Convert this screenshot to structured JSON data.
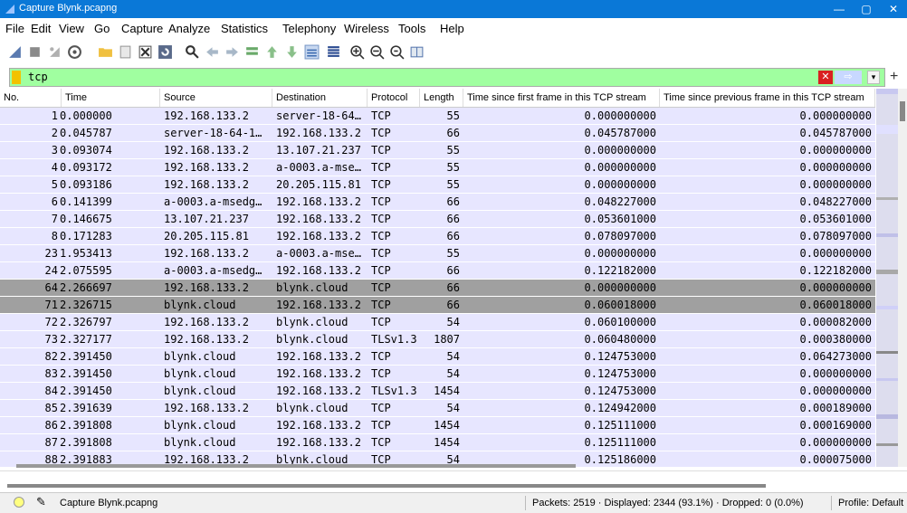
{
  "window": {
    "title": "Capture Blynk.pcapng",
    "minimize": "—",
    "maximize": "▢",
    "close": "✕"
  },
  "menu": [
    "File",
    "Edit",
    "View",
    "Go",
    "Capture",
    "Analyze",
    "Statistics",
    "Telephony",
    "Wireless",
    "Tools",
    "Help"
  ],
  "toolbar": [
    "shark-fin-start-icon",
    "stop-icon",
    "restart-icon",
    "options-gear-icon",
    "open-folder-icon",
    "save-file-icon",
    "close-file-icon",
    "reload-icon",
    "find-icon",
    "back-arrow-icon",
    "forward-arrow-icon",
    "go-to-packet-icon",
    "first-packet-icon",
    "last-packet-icon",
    "autoscroll-icon",
    "colorize-icon",
    "zoom-in-icon",
    "zoom-out-icon",
    "normal-size-icon",
    "resize-columns-icon"
  ],
  "filter": {
    "value": "tcp",
    "clear": "✕",
    "apply": "⇨",
    "dropdown": "▾",
    "add": "+"
  },
  "columns": [
    "No.",
    "Time",
    "Source",
    "Destination",
    "Protocol",
    "Length",
    "Time since first frame in this TCP stream",
    "Time since previous frame in this TCP stream"
  ],
  "packets": [
    {
      "no": "1",
      "time": "0.000000",
      "src": "192.168.133.2",
      "dst": "server-18-64…",
      "proto": "TCP",
      "len": "55",
      "first": "0.000000000",
      "prev": "0.000000000",
      "sel": false
    },
    {
      "no": "2",
      "time": "0.045787",
      "src": "server-18-64-1…",
      "dst": "192.168.133.2",
      "proto": "TCP",
      "len": "66",
      "first": "0.045787000",
      "prev": "0.045787000",
      "sel": false
    },
    {
      "no": "3",
      "time": "0.093074",
      "src": "192.168.133.2",
      "dst": "13.107.21.237",
      "proto": "TCP",
      "len": "55",
      "first": "0.000000000",
      "prev": "0.000000000",
      "sel": false
    },
    {
      "no": "4",
      "time": "0.093172",
      "src": "192.168.133.2",
      "dst": "a-0003.a-mse…",
      "proto": "TCP",
      "len": "55",
      "first": "0.000000000",
      "prev": "0.000000000",
      "sel": false
    },
    {
      "no": "5",
      "time": "0.093186",
      "src": "192.168.133.2",
      "dst": "20.205.115.81",
      "proto": "TCP",
      "len": "55",
      "first": "0.000000000",
      "prev": "0.000000000",
      "sel": false
    },
    {
      "no": "6",
      "time": "0.141399",
      "src": "a-0003.a-msedg…",
      "dst": "192.168.133.2",
      "proto": "TCP",
      "len": "66",
      "first": "0.048227000",
      "prev": "0.048227000",
      "sel": false
    },
    {
      "no": "7",
      "time": "0.146675",
      "src": "13.107.21.237",
      "dst": "192.168.133.2",
      "proto": "TCP",
      "len": "66",
      "first": "0.053601000",
      "prev": "0.053601000",
      "sel": false
    },
    {
      "no": "8",
      "time": "0.171283",
      "src": "20.205.115.81",
      "dst": "192.168.133.2",
      "proto": "TCP",
      "len": "66",
      "first": "0.078097000",
      "prev": "0.078097000",
      "sel": false
    },
    {
      "no": "23",
      "time": "1.953413",
      "src": "192.168.133.2",
      "dst": "a-0003.a-mse…",
      "proto": "TCP",
      "len": "55",
      "first": "0.000000000",
      "prev": "0.000000000",
      "sel": false
    },
    {
      "no": "24",
      "time": "2.075595",
      "src": "a-0003.a-msedg…",
      "dst": "192.168.133.2",
      "proto": "TCP",
      "len": "66",
      "first": "0.122182000",
      "prev": "0.122182000",
      "sel": false
    },
    {
      "no": "64",
      "time": "2.266697",
      "src": "192.168.133.2",
      "dst": "blynk.cloud",
      "proto": "TCP",
      "len": "66",
      "first": "0.000000000",
      "prev": "0.000000000",
      "sel": true
    },
    {
      "no": "71",
      "time": "2.326715",
      "src": "blynk.cloud",
      "dst": "192.168.133.2",
      "proto": "TCP",
      "len": "66",
      "first": "0.060018000",
      "prev": "0.060018000",
      "sel": true
    },
    {
      "no": "72",
      "time": "2.326797",
      "src": "192.168.133.2",
      "dst": "blynk.cloud",
      "proto": "TCP",
      "len": "54",
      "first": "0.060100000",
      "prev": "0.000082000",
      "sel": false
    },
    {
      "no": "73",
      "time": "2.327177",
      "src": "192.168.133.2",
      "dst": "blynk.cloud",
      "proto": "TLSv1.3",
      "len": "1807",
      "first": "0.060480000",
      "prev": "0.000380000",
      "sel": false
    },
    {
      "no": "82",
      "time": "2.391450",
      "src": "blynk.cloud",
      "dst": "192.168.133.2",
      "proto": "TCP",
      "len": "54",
      "first": "0.124753000",
      "prev": "0.064273000",
      "sel": false
    },
    {
      "no": "83",
      "time": "2.391450",
      "src": "blynk.cloud",
      "dst": "192.168.133.2",
      "proto": "TCP",
      "len": "54",
      "first": "0.124753000",
      "prev": "0.000000000",
      "sel": false
    },
    {
      "no": "84",
      "time": "2.391450",
      "src": "blynk.cloud",
      "dst": "192.168.133.2",
      "proto": "TLSv1.3",
      "len": "1454",
      "first": "0.124753000",
      "prev": "0.000000000",
      "sel": false
    },
    {
      "no": "85",
      "time": "2.391639",
      "src": "192.168.133.2",
      "dst": "blynk.cloud",
      "proto": "TCP",
      "len": "54",
      "first": "0.124942000",
      "prev": "0.000189000",
      "sel": false
    },
    {
      "no": "86",
      "time": "2.391808",
      "src": "blynk.cloud",
      "dst": "192.168.133.2",
      "proto": "TCP",
      "len": "1454",
      "first": "0.125111000",
      "prev": "0.000169000",
      "sel": false
    },
    {
      "no": "87",
      "time": "2.391808",
      "src": "blynk.cloud",
      "dst": "192.168.133.2",
      "proto": "TCP",
      "len": "1454",
      "first": "0.125111000",
      "prev": "0.000000000",
      "sel": false
    },
    {
      "no": "88",
      "time": "2.391883",
      "src": "192.168.133.2",
      "dst": "blynk.cloud",
      "proto": "TCP",
      "len": "54",
      "first": "0.125186000",
      "prev": "0.000075000",
      "sel": false
    }
  ],
  "status": {
    "file": "Capture Blynk.pcapng",
    "packets": "Packets: 2519 · Displayed: 2344 (93.1%) · Dropped: 0 (0.0%)",
    "profile": "Profile: Default"
  },
  "colors": {
    "row_bg": "#e7e6ff",
    "row_selected": "#a0a0a0",
    "filter_ok": "#a0ffa0",
    "titlebar": "#0a78d7"
  }
}
